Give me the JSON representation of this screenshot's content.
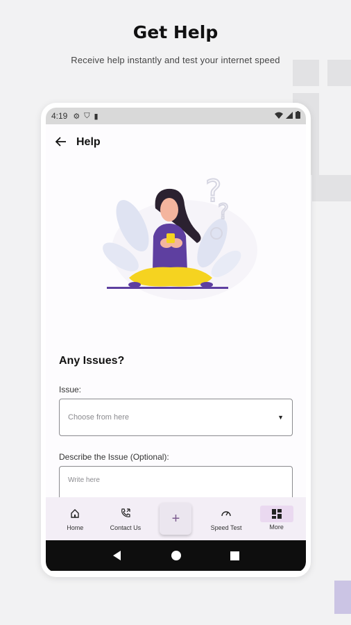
{
  "hero": {
    "title": "Get Help",
    "subtitle": "Receive help instantly and test your internet speed"
  },
  "status_bar": {
    "time": "4:19"
  },
  "app_bar": {
    "title": "Help"
  },
  "form": {
    "section_title": "Any Issues?",
    "issue_label": "Issue:",
    "issue_placeholder": "Choose from here",
    "describe_label": "Describe the Issue (Optional):",
    "describe_placeholder": "Write here"
  },
  "bottom_nav": {
    "items": [
      {
        "label": "Home",
        "icon": "home-icon"
      },
      {
        "label": "Contact Us",
        "icon": "phone-icon"
      },
      {
        "label": "+",
        "icon": "add-icon"
      },
      {
        "label": "Speed Test",
        "icon": "speedometer-icon"
      },
      {
        "label": "More",
        "icon": "grid-icon"
      }
    ]
  },
  "colors": {
    "accent": "#5e3fa0",
    "nav_background": "#f3eef6",
    "more_highlight": "#ead9f0",
    "illustration_yellow": "#f5d320",
    "system_nav": "#0e0e0e"
  }
}
